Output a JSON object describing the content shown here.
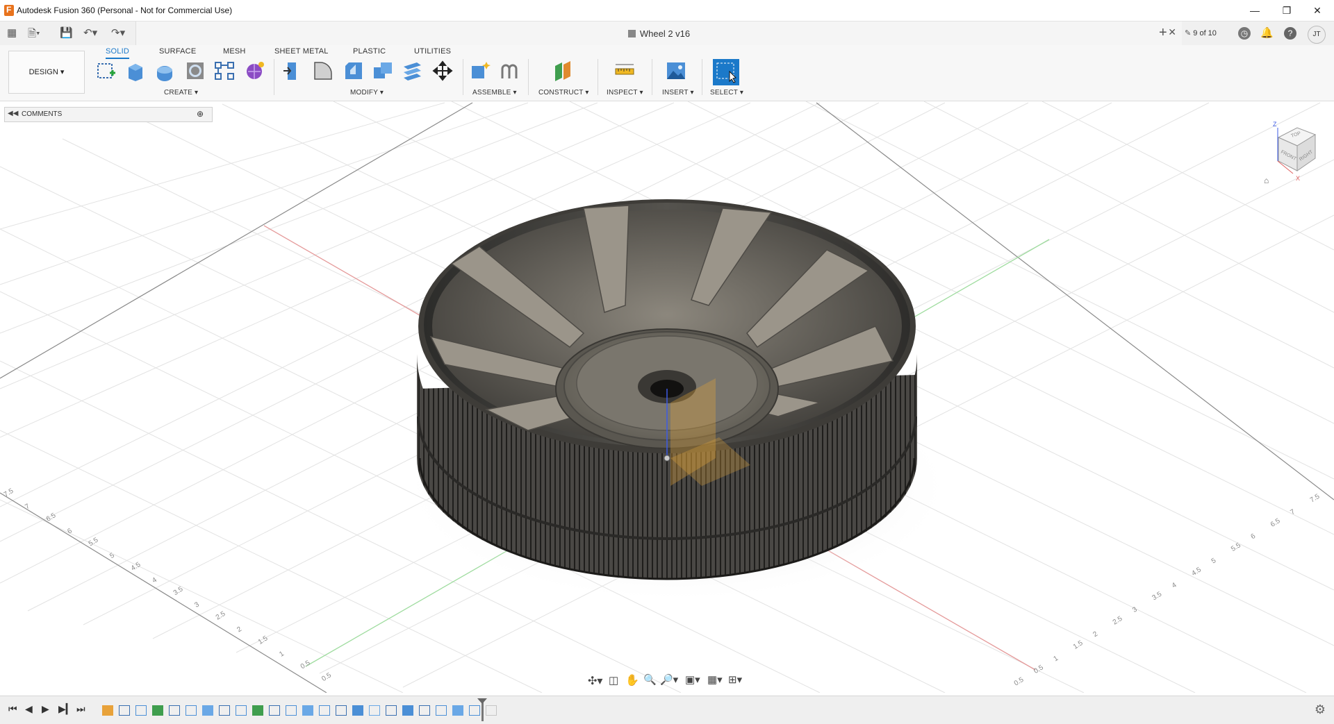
{
  "window": {
    "title": "Autodesk Fusion 360 (Personal - Not for Commercial Use)",
    "controls": [
      "minimize",
      "restore",
      "close"
    ]
  },
  "tabbar": {
    "document_title": "Wheel 2 v16",
    "version_counter": "9 of 10",
    "user_initials": "JT"
  },
  "toolbar": {
    "workspace": "DESIGN",
    "tabs": [
      {
        "label": "SOLID",
        "active": true
      },
      {
        "label": "SURFACE",
        "active": false
      },
      {
        "label": "MESH",
        "active": false
      },
      {
        "label": "SHEET METAL",
        "active": false
      },
      {
        "label": "PLASTIC",
        "active": false
      },
      {
        "label": "UTILITIES",
        "active": false
      }
    ],
    "groups": {
      "create": "CREATE",
      "modify": "MODIFY",
      "assemble": "ASSEMBLE",
      "construct": "CONSTRUCT",
      "inspect": "INSPECT",
      "insert": "INSERT",
      "select": "SELECT"
    }
  },
  "comments": {
    "label": "COMMENTS"
  },
  "viewcube": {
    "top": "TOP",
    "front": "FRONT",
    "right": "RIGHT",
    "z": "Z",
    "x": "X"
  },
  "grid_ticks": {
    "left": [
      "7.5",
      "7",
      "6.5",
      "6",
      "5.5",
      "5",
      "4.5",
      "4",
      "3.5",
      "3",
      "2.5",
      "2",
      "1.5",
      "1",
      "0.5",
      "0.5"
    ],
    "right": [
      "0.5",
      "0.5",
      "1",
      "1.5",
      "2",
      "2.5",
      "3",
      "3.5",
      "4",
      "4.5",
      "5",
      "5.5",
      "6",
      "6.5",
      "7",
      "7.5"
    ]
  },
  "colors": {
    "accent": "#1b79c9",
    "x_axis": "#e28a8a",
    "y_axis": "#8fd68f",
    "z_axis": "#3c5be6"
  }
}
